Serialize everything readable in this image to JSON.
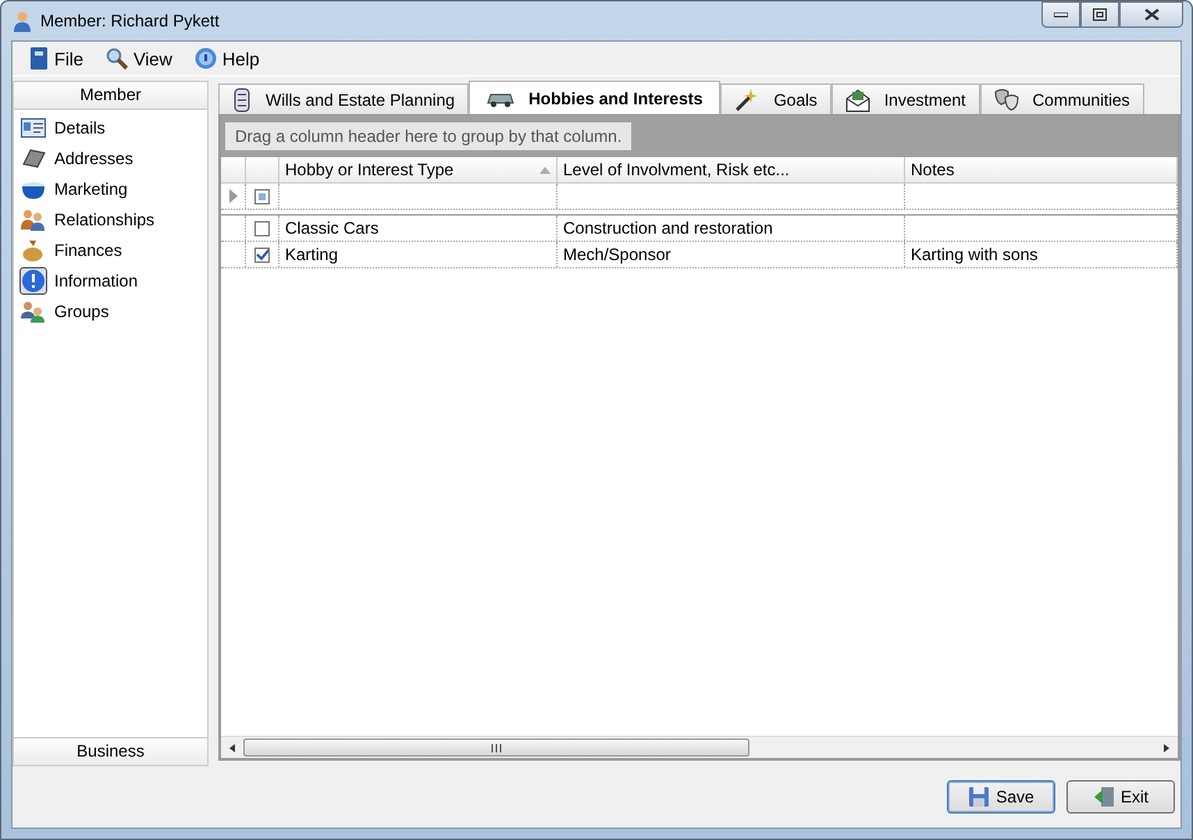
{
  "window": {
    "title": "Member: Richard Pykett"
  },
  "menu": [
    "File",
    "View",
    "Help"
  ],
  "sidebar": {
    "header": "Member",
    "items": [
      {
        "label": "Details",
        "selected": false
      },
      {
        "label": "Addresses",
        "selected": false
      },
      {
        "label": "Marketing",
        "selected": false
      },
      {
        "label": "Relationships",
        "selected": false
      },
      {
        "label": "Finances",
        "selected": false
      },
      {
        "label": "Information",
        "selected": true
      },
      {
        "label": "Groups",
        "selected": false
      }
    ],
    "footer": "Business"
  },
  "tabs": [
    {
      "label": "Wills and Estate Planning",
      "selected": false
    },
    {
      "label": "Hobbies and Interests",
      "selected": true
    },
    {
      "label": "Goals",
      "selected": false
    },
    {
      "label": "Investment",
      "selected": false
    },
    {
      "label": "Communities",
      "selected": false
    }
  ],
  "group_panel": "Drag a column header here to group by that column.",
  "table": {
    "columns": [
      "Hobby or Interest Type",
      "Level of Involvment, Risk etc...",
      "Notes"
    ],
    "new_row": {
      "indeterminate": true
    },
    "rows": [
      {
        "checked": false,
        "cells": [
          "Classic Cars",
          "Construction and restoration",
          ""
        ]
      },
      {
        "checked": true,
        "cells": [
          "Karting",
          "Mech/Sponsor",
          "Karting with sons"
        ]
      }
    ]
  },
  "buttons": [
    "Save",
    "Exit"
  ]
}
